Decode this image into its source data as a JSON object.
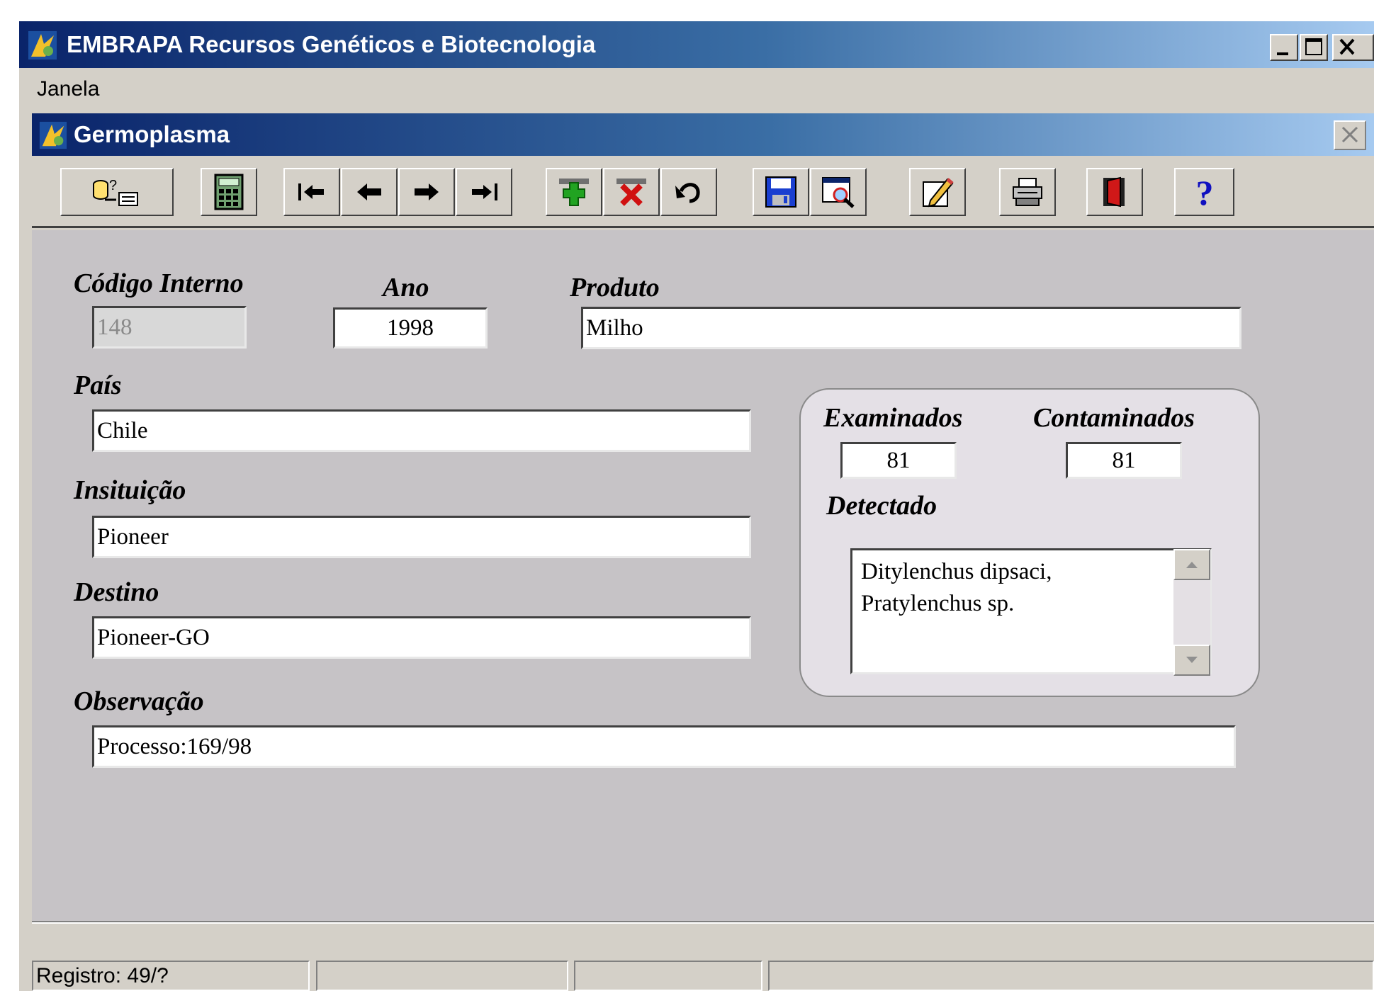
{
  "app": {
    "title": "EMBRAPA Recursos Genéticos e Biotecnologia",
    "menu": [
      "Janela"
    ]
  },
  "child": {
    "title": "Germoplasma",
    "toolbar": [
      {
        "name": "query-data-icon"
      },
      {
        "name": "calculator-icon"
      },
      {
        "name": "first-record-icon"
      },
      {
        "name": "previous-record-icon"
      },
      {
        "name": "next-record-icon"
      },
      {
        "name": "last-record-icon"
      },
      {
        "name": "add-record-icon"
      },
      {
        "name": "delete-record-icon"
      },
      {
        "name": "undo-icon"
      },
      {
        "name": "save-icon"
      },
      {
        "name": "search-form-icon"
      },
      {
        "name": "edit-pencil-icon"
      },
      {
        "name": "print-icon"
      },
      {
        "name": "exit-door-icon"
      },
      {
        "name": "help-icon"
      }
    ]
  },
  "form": {
    "codigo_interno": {
      "label": "Código Interno",
      "value": "148"
    },
    "ano": {
      "label": "Ano",
      "value": "1998"
    },
    "produto": {
      "label": "Produto",
      "value": "Milho"
    },
    "pais": {
      "label": "País",
      "value": "Chile"
    },
    "instituicao": {
      "label": "Insituição",
      "value": "Pioneer"
    },
    "destino": {
      "label": "Destino",
      "value": "Pioneer-GO"
    },
    "observacao": {
      "label": "Observação",
      "value": "Processo:169/98"
    },
    "examinados": {
      "label": "Examinados",
      "value": "81"
    },
    "contaminados": {
      "label": "Contaminados",
      "value": "81"
    },
    "detectado": {
      "label": "Detectado",
      "lines": [
        "Ditylenchus dipsaci,",
        "Pratylenchus sp."
      ]
    }
  },
  "status": {
    "record": "Registro: 49/?"
  },
  "colors": {
    "titlebar_start": "#0a246a",
    "titlebar_end": "#a6caf0",
    "form_bg": "#c6c3c6"
  }
}
